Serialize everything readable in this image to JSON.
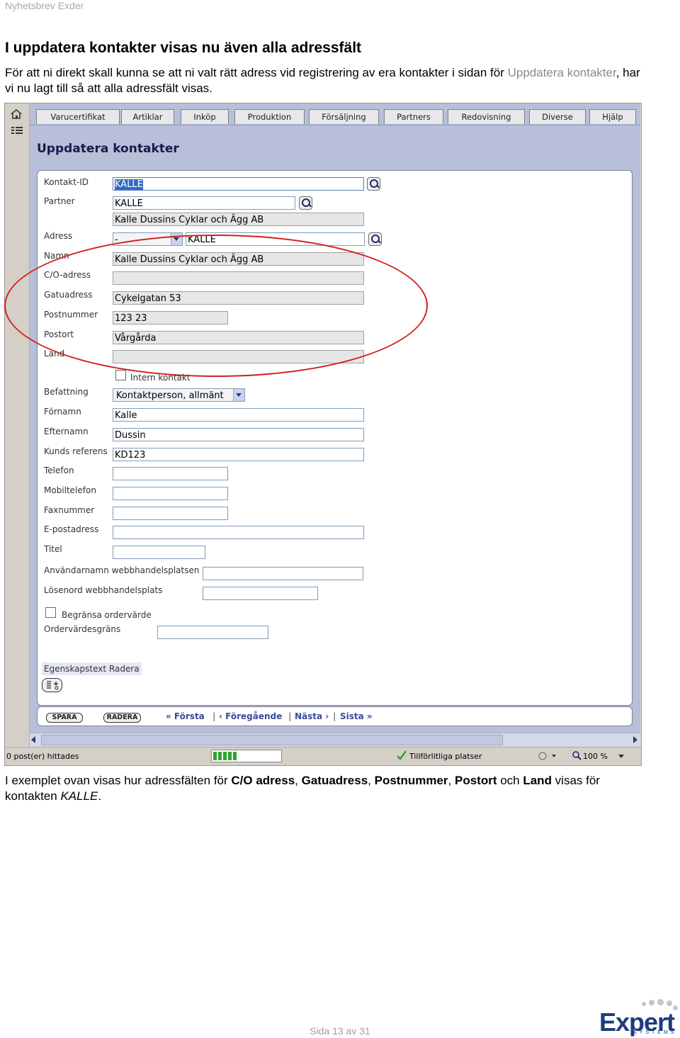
{
  "doc": {
    "header": "Nyhetsbrev Exder",
    "title": "I uppdatera kontakter visas nu även alla adressfält",
    "intro_1": "För att ni direkt skall kunna se att ni valt rätt adress vid registrering av era kontakter i sidan för ",
    "intro_link": "Uppdatera kontakter",
    "intro_2": ", har vi nu lagt till så att alla adressfält visas.",
    "outro_1": "I exemplet ovan visas hur adressfälten för ",
    "outro_b1": "C/O adress",
    "outro_s1": ", ",
    "outro_b2": "Gatuadress",
    "outro_s2": ", ",
    "outro_b3": "Postnummer",
    "outro_s3": ", ",
    "outro_b4": "Postort",
    "outro_s4": " och ",
    "outro_b5": "Land",
    "outro_2": " visas för kontakten ",
    "outro_i": "KALLE",
    "outro_3": ".",
    "footer": "Sida 13 av 31",
    "logo_text": "Expert",
    "logo_sub": "SYSTEMS"
  },
  "app": {
    "nav": [
      "Varucertifikat",
      "Artiklar",
      "Inköp",
      "Produktion",
      "Försäljning",
      "Partners",
      "Redovisning",
      "Diverse",
      "Hjälp"
    ],
    "page_title": "Uppdatera kontakter",
    "labels": {
      "kontakt_id": "Kontakt-ID",
      "partner": "Partner",
      "adress": "Adress",
      "namn": "Namn",
      "co": "C/O-adress",
      "gatu": "Gatuadress",
      "postnr": "Postnummer",
      "postort": "Postort",
      "land": "Land",
      "intern": "Intern kontakt",
      "befattning": "Befattning",
      "fornamn": "Förnamn",
      "efternamn": "Efternamn",
      "kundsref": "Kunds referens",
      "telefon": "Telefon",
      "mobil": "Mobiltelefon",
      "fax": "Faxnummer",
      "epost": "E-postadress",
      "titel": "Titel",
      "anvnamn": "Användarnamn webbhandelsplatsen",
      "losenord": "Lösenord webbhandelsplats",
      "begransa": "Begränsa ordervärde",
      "ordergrans": "Ordervärdesgräns",
      "egenskap": "Egenskapstext Radera"
    },
    "values": {
      "kontakt_id": "KALLE",
      "partner": "KALLE",
      "partner_name": "Kalle Dussins Cyklar och Ägg AB",
      "adress_select": "-",
      "adress": "KALLE",
      "namn": "Kalle Dussins Cyklar och Ägg AB",
      "co": "",
      "gatu": "Cykelgatan 53",
      "postnr": "123 23",
      "postort": "Vårgårda",
      "land": "",
      "befattning": "Kontaktperson, allmänt",
      "fornamn": "Kalle",
      "efternamn": "Dussin",
      "kundsref": "KD123",
      "telefon": "",
      "mobil": "",
      "fax": "",
      "epost": "",
      "titel": "",
      "anvnamn": "",
      "losenord": "",
      "ordergrans": ""
    },
    "buttons": {
      "spara": "SPARA",
      "radera": "RADERA"
    },
    "pager": {
      "first": "« Första",
      "prev": "‹ Föregående",
      "next": "Nästa ›",
      "last": "Sista »",
      "sep": "|"
    },
    "status": {
      "hits": "0 post(er) hittades",
      "zone": "Tillförlitliga platser",
      "zoom": "100 %"
    }
  }
}
